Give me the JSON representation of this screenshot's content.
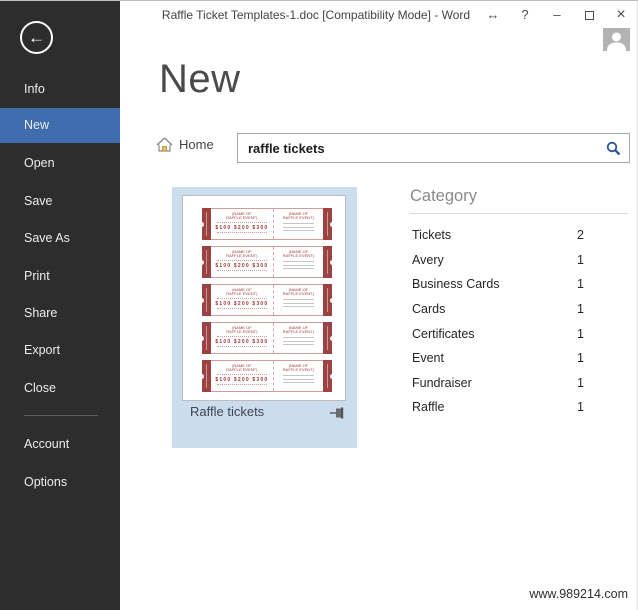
{
  "window": {
    "title": "Raffle Ticket Templates-1.doc [Compatibility Mode] - Word",
    "controls": {
      "fullscreen_glyph": "↔",
      "help_glyph": "?",
      "minimize_glyph": "–",
      "close_glyph": "×"
    }
  },
  "sidebar": {
    "back_glyph": "←",
    "items": [
      {
        "label": "Info"
      },
      {
        "label": "New"
      },
      {
        "label": "Open"
      },
      {
        "label": "Save"
      },
      {
        "label": "Save As"
      },
      {
        "label": "Print"
      },
      {
        "label": "Share"
      },
      {
        "label": "Export"
      },
      {
        "label": "Close"
      },
      {
        "label": "Account"
      },
      {
        "label": "Options"
      }
    ],
    "selected_item": "New"
  },
  "page": {
    "heading": "New"
  },
  "breadcrumb": {
    "home_label": "Home"
  },
  "search": {
    "value": "raffle tickets"
  },
  "template": {
    "label": "Raffle tickets",
    "ticket": {
      "header_line1": "(NAME OF",
      "header_line2": "RAFFLE EVENT)",
      "prices": "$100 $200 $300"
    }
  },
  "category": {
    "title": "Category",
    "rows": [
      {
        "name": "Tickets",
        "count": "2"
      },
      {
        "name": "Avery",
        "count": "1"
      },
      {
        "name": "Business Cards",
        "count": "1"
      },
      {
        "name": "Cards",
        "count": "1"
      },
      {
        "name": "Certificates",
        "count": "1"
      },
      {
        "name": "Event",
        "count": "1"
      },
      {
        "name": "Fundraiser",
        "count": "1"
      },
      {
        "name": "Raffle",
        "count": "1"
      }
    ]
  },
  "watermark": {
    "text": "www.989214.com"
  },
  "colors": {
    "sidebar_bg": "#2d2d2d",
    "accent_selected": "#3e6cac",
    "tile_selected": "#cbdced",
    "ticket_red": "#9c4242",
    "search_icon_blue": "#2b579a"
  }
}
